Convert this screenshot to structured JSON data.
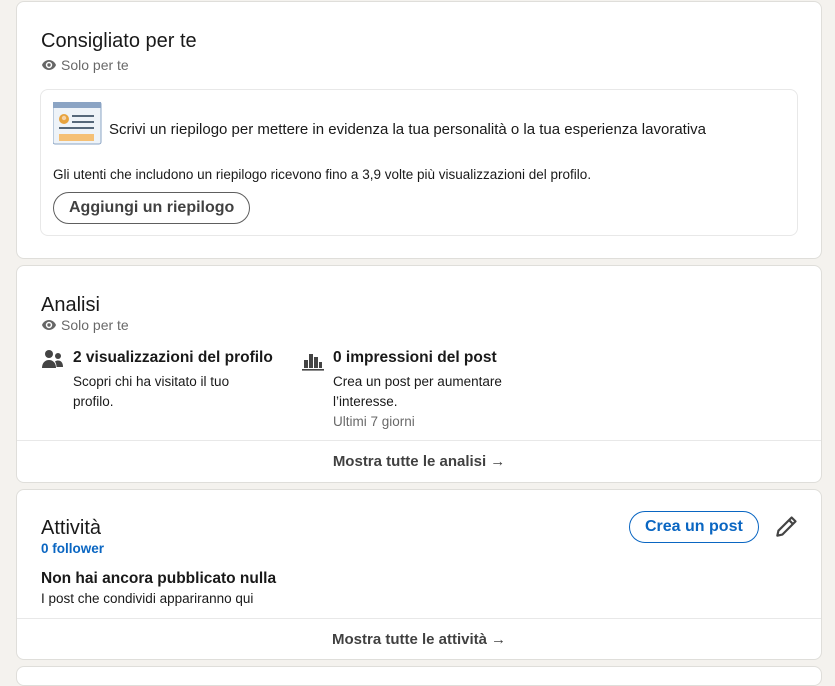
{
  "recommended": {
    "title": "Consigliato per te",
    "visibility": "Solo per te",
    "suggestion": {
      "headline": "Scrivi un riepilogo per mettere in evidenza la tua personalità o la tua esperienza lavorativa",
      "description": "Gli utenti che includono un riepilogo ricevono fino a 3,9 volte più visualizzazioni del profilo.",
      "button_label": "Aggiungi un riepilogo"
    }
  },
  "analytics": {
    "title": "Analisi",
    "visibility": "Solo per te",
    "profile_views": {
      "title": "2 visualizzazioni del profilo",
      "description": "Scopri chi ha visitato il tuo profilo."
    },
    "post_impressions": {
      "title": "0 impressioni del post",
      "description": "Crea un post per aumentare l’interesse.",
      "range": "Ultimi 7 giorni"
    },
    "show_all_label": "Mostra tutte le analisi",
    "arrow": "→"
  },
  "activity": {
    "title": "Attività",
    "followers": "0 follower",
    "create_post_label": "Crea un post",
    "empty_title": "Non hai ancora pubblicato nulla",
    "empty_description": "I post che condividi appariranno qui",
    "show_all_label": "Mostra tutte le attività",
    "arrow": "→"
  },
  "colors": {
    "accent": "#0a66c2",
    "background": "#f4f2ee",
    "card": "#ffffff"
  },
  "icons": {
    "visibility": "eye-icon",
    "summary": "profile-summary-illustration",
    "views": "people-icon",
    "impressions": "bar-chart-icon",
    "edit": "pencil-icon",
    "arrow": "right-arrow-icon"
  }
}
